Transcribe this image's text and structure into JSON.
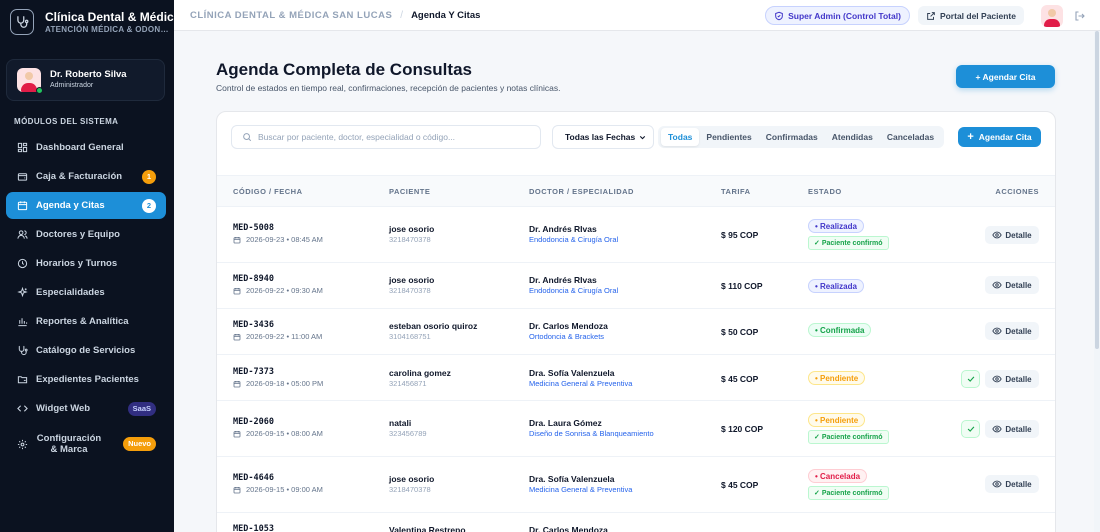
{
  "brand": {
    "title": "Clínica Dental & Médic…",
    "subtitle": "ATENCIÓN MÉDICA & ODON…"
  },
  "user": {
    "name": "Dr. Roberto Silva",
    "role": "Administrador"
  },
  "sidebar": {
    "section_title": "MÓDULOS DEL SISTEMA",
    "items": [
      {
        "label": "Dashboard General",
        "icon": "grid-icon"
      },
      {
        "label": "Caja & Facturación",
        "icon": "wallet-icon",
        "badge": "1"
      },
      {
        "label": "Agenda y Citas",
        "icon": "calendar-icon",
        "badge": "2",
        "active": true
      },
      {
        "label": "Doctores y Equipo",
        "icon": "users-icon"
      },
      {
        "label": "Horarios y Turnos",
        "icon": "clock-icon"
      },
      {
        "label": "Especialidades",
        "icon": "sparkle-icon"
      },
      {
        "label": "Reportes & Analítica",
        "icon": "bar-chart-icon"
      },
      {
        "label": "Catálogo de Servicios",
        "icon": "stethoscope-icon"
      },
      {
        "label": "Expedientes Pacientes",
        "icon": "folder-icon"
      },
      {
        "label": "Widget Web",
        "icon": "code-icon",
        "badge": "SaaS"
      },
      {
        "label": "Configuración & Marca",
        "icon": "gear-icon",
        "badge": "Nuevo"
      }
    ]
  },
  "topbar": {
    "breadcrumb_root": "CLÍNICA DENTAL & MÉDICA SAN LUCAS",
    "breadcrumb_sep": "/",
    "breadcrumb_current": "Agenda Y Citas",
    "role_pill": "Super Admin (Control Total)",
    "portal_button": "Portal del Paciente"
  },
  "main": {
    "title": "Agenda Completa de Consultas",
    "subtitle": "Control de estados en tiempo real, confirmaciones, recepción de pacientes y notas clínicas.",
    "primary_button": "+ Agendar Cita"
  },
  "toolbar": {
    "search_placeholder": "Buscar por paciente, doctor, especialidad o código...",
    "date_filter": "Todas las Fechas",
    "filters": [
      "Todas",
      "Pendientes",
      "Confirmadas",
      "Atendidas",
      "Canceladas"
    ],
    "add_button": "Agendar Cita"
  },
  "table": {
    "columns": [
      "CÓDIGO / FECHA",
      "PACIENTE",
      "DOCTOR / ESPECIALIDAD",
      "TARIFA",
      "ESTADO",
      "ACCIONES"
    ],
    "detail_label": "Detalle",
    "confirm_label": "Paciente confirmó",
    "rows": [
      {
        "code": "MED-5008",
        "datetime": "2026-09-23 • 08:45 AM",
        "patient": "jose osorio",
        "phone": "3218470378",
        "doctor": "Dr. Andrés RIvas",
        "specialty": "Endodoncia & Cirugía Oral",
        "fee": "$ 95 COP",
        "status": "• Realizada",
        "status_type": "realizada",
        "confirmed": true,
        "check": false
      },
      {
        "code": "MED-8940",
        "datetime": "2026-09-22 • 09:30 AM",
        "patient": "jose osorio",
        "phone": "3218470378",
        "doctor": "Dr. Andrés RIvas",
        "specialty": "Endodoncia & Cirugía Oral",
        "fee": "$ 110 COP",
        "status": "• Realizada",
        "status_type": "realizada",
        "confirmed": false,
        "check": false
      },
      {
        "code": "MED-3436",
        "datetime": "2026-09-22 • 11:00 AM",
        "patient": "esteban osorio quiroz",
        "phone": "3104168751",
        "doctor": "Dr. Carlos Mendoza",
        "specialty": "Ortodoncia & Brackets",
        "fee": "$ 50 COP",
        "status": "• Confirmada",
        "status_type": "confirmada",
        "confirmed": false,
        "check": false
      },
      {
        "code": "MED-7373",
        "datetime": "2026-09-18 • 05:00 PM",
        "patient": "carolina gomez",
        "phone": "321456871",
        "doctor": "Dra. Sofía Valenzuela",
        "specialty": "Medicina General & Preventiva",
        "fee": "$ 45 COP",
        "status": "• Pendiente",
        "status_type": "pendiente",
        "confirmed": false,
        "check": true
      },
      {
        "code": "MED-2060",
        "datetime": "2026-09-15 • 08:00 AM",
        "patient": "natali",
        "phone": "323456789",
        "doctor": "Dra. Laura Gómez",
        "specialty": "Diseño de Sonrisa & Blanqueamiento",
        "fee": "$ 120 COP",
        "status": "• Pendiente",
        "status_type": "pendiente",
        "confirmed": true,
        "check": true
      },
      {
        "code": "MED-4646",
        "datetime": "2026-09-15 • 09:00 AM",
        "patient": "jose osorio",
        "phone": "3218470378",
        "doctor": "Dra. Sofía Valenzuela",
        "specialty": "Medicina General & Preventiva",
        "fee": "$ 45 COP",
        "status": "• Cancelada",
        "status_type": "cancelada",
        "confirmed": true,
        "check": false
      },
      {
        "code": "MED-1053",
        "datetime": "",
        "patient": "Valentina Restrepo",
        "phone": "",
        "doctor": "Dr. Carlos Mendoza",
        "specialty": "",
        "fee": "",
        "status": "",
        "status_type": "realizada",
        "confirmed": false,
        "check": false
      }
    ]
  },
  "colors": {
    "accent": "#1d8fd8",
    "sidebar_bg": "#0b1220"
  }
}
